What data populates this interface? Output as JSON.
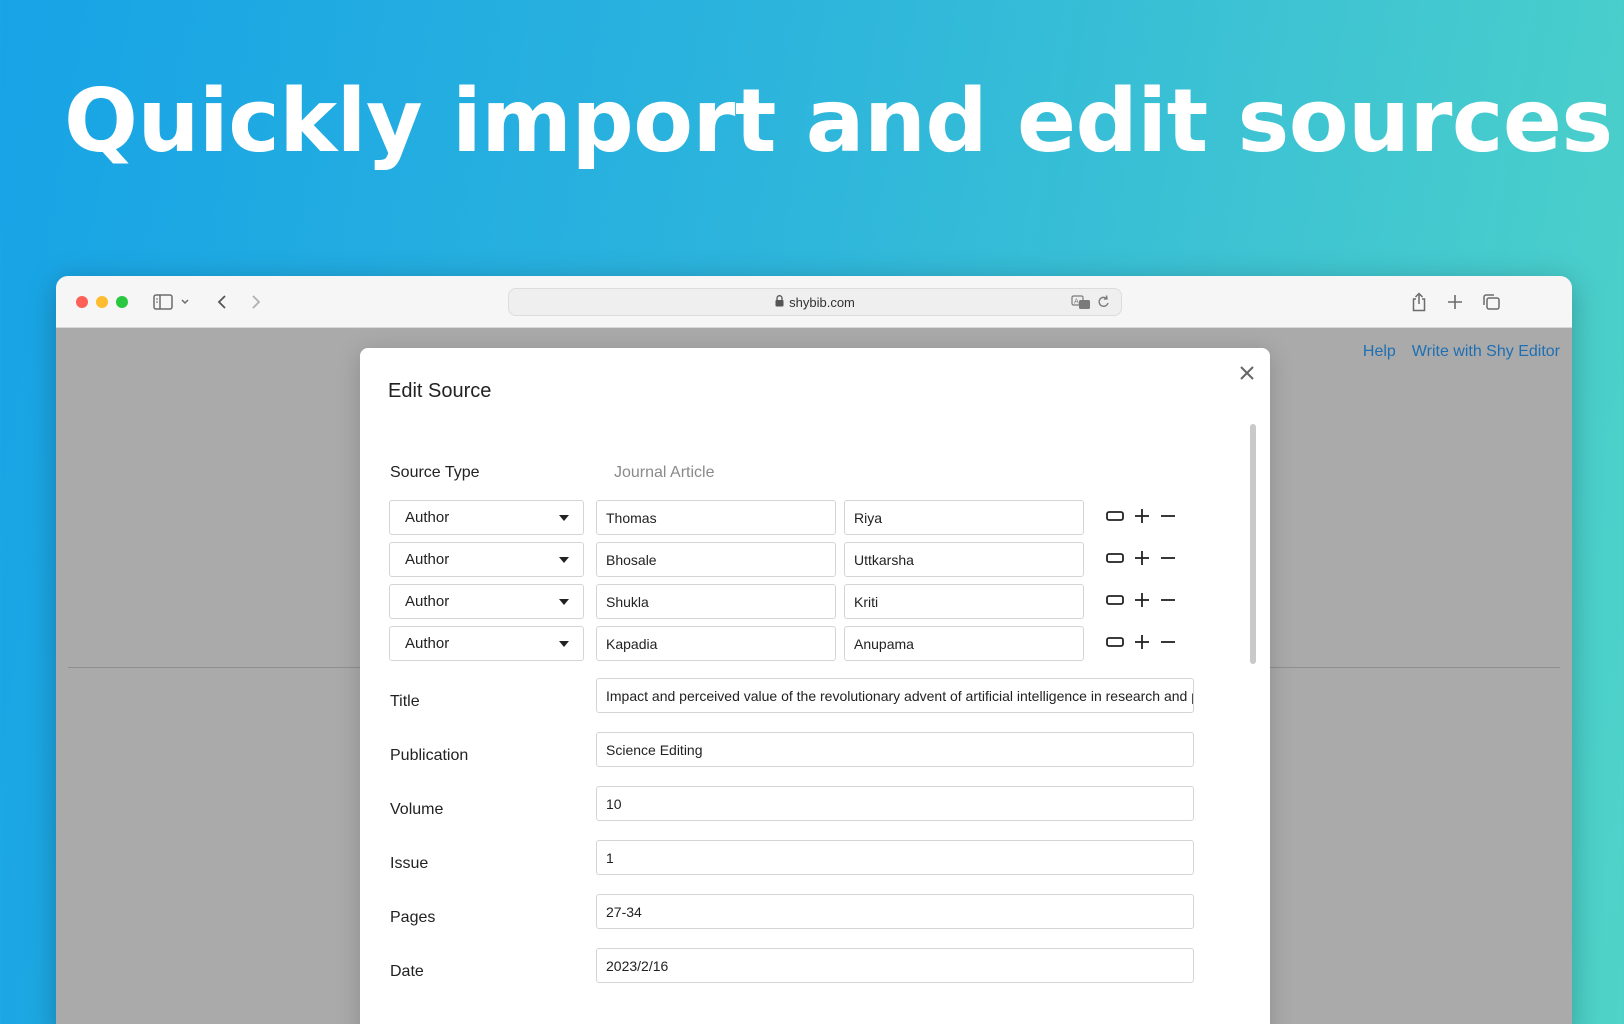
{
  "headline": "Quickly import and edit sources",
  "browser": {
    "url": "shybib.com"
  },
  "page": {
    "links": [
      "Help",
      "Write with Shy Editor"
    ]
  },
  "modal": {
    "title": "Edit Source",
    "source_type_label": "Source Type",
    "source_type_value": "Journal Article",
    "contributors": [
      {
        "role": "Author",
        "last": "Thomas",
        "first": "Riya"
      },
      {
        "role": "Author",
        "last": "Bhosale",
        "first": "Uttkarsha"
      },
      {
        "role": "Author",
        "last": "Shukla",
        "first": "Kriti"
      },
      {
        "role": "Author",
        "last": "Kapadia",
        "first": "Anupama"
      }
    ],
    "fields": [
      {
        "label": "Title",
        "value": "Impact and perceived value of the revolutionary advent of artificial intelligence in research and publ"
      },
      {
        "label": "Publication",
        "value": "Science Editing"
      },
      {
        "label": "Volume",
        "value": "10"
      },
      {
        "label": "Issue",
        "value": "1"
      },
      {
        "label": "Pages",
        "value": "27-34"
      },
      {
        "label": "Date",
        "value": "2023/2/16"
      }
    ]
  },
  "colors": {
    "link": "#1e6fb3",
    "overlay": "#aaaaaa"
  }
}
